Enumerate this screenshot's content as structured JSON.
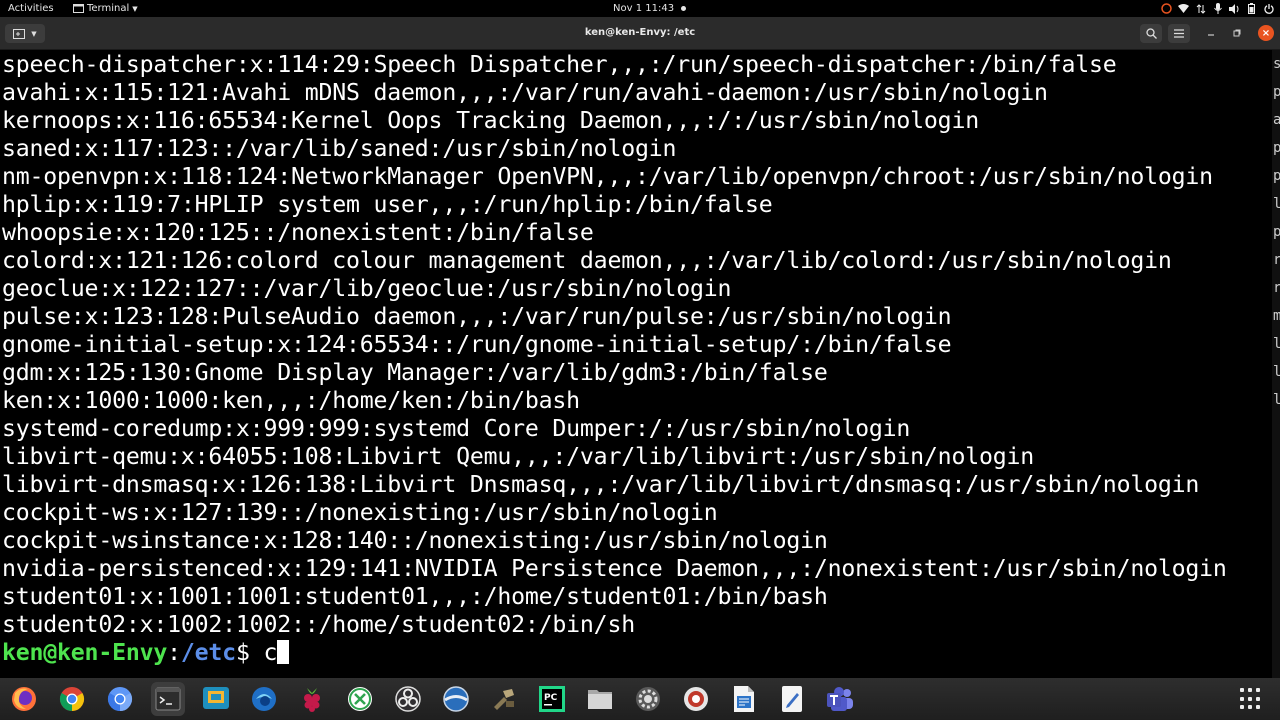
{
  "topbar": {
    "activities": "Activities",
    "app_menu": "Terminal",
    "clock": "Nov 1  11:43"
  },
  "window": {
    "title": "ken@ken-Envy: /etc"
  },
  "terminal": {
    "lines": [
      "speech-dispatcher:x:114:29:Speech Dispatcher,,,:/run/speech-dispatcher:/bin/false",
      "avahi:x:115:121:Avahi mDNS daemon,,,:/var/run/avahi-daemon:/usr/sbin/nologin",
      "kernoops:x:116:65534:Kernel Oops Tracking Daemon,,,:/:/usr/sbin/nologin",
      "saned:x:117:123::/var/lib/saned:/usr/sbin/nologin",
      "nm-openvpn:x:118:124:NetworkManager OpenVPN,,,:/var/lib/openvpn/chroot:/usr/sbin/nologin",
      "hplip:x:119:7:HPLIP system user,,,:/run/hplip:/bin/false",
      "whoopsie:x:120:125::/nonexistent:/bin/false",
      "colord:x:121:126:colord colour management daemon,,,:/var/lib/colord:/usr/sbin/nologin",
      "geoclue:x:122:127::/var/lib/geoclue:/usr/sbin/nologin",
      "pulse:x:123:128:PulseAudio daemon,,,:/var/run/pulse:/usr/sbin/nologin",
      "gnome-initial-setup:x:124:65534::/run/gnome-initial-setup/:/bin/false",
      "gdm:x:125:130:Gnome Display Manager:/var/lib/gdm3:/bin/false",
      "ken:x:1000:1000:ken,,,:/home/ken:/bin/bash",
      "systemd-coredump:x:999:999:systemd Core Dumper:/:/usr/sbin/nologin",
      "libvirt-qemu:x:64055:108:Libvirt Qemu,,,:/var/lib/libvirt:/usr/sbin/nologin",
      "libvirt-dnsmasq:x:126:138:Libvirt Dnsmasq,,,:/var/lib/libvirt/dnsmasq:/usr/sbin/nologin",
      "cockpit-ws:x:127:139::/nonexisting:/usr/sbin/nologin",
      "cockpit-wsinstance:x:128:140::/nonexisting:/usr/sbin/nologin",
      "nvidia-persistenced:x:129:141:NVIDIA Persistence Daemon,,,:/nonexistent:/usr/sbin/nologin",
      "student01:x:1001:1001:student01,,,:/home/student01:/bin/bash",
      "student02:x:1002:1002::/home/student02:/bin/sh"
    ],
    "prompt": {
      "user_host": "ken@ken-Envy",
      "colon": ":",
      "path": "/etc",
      "symbol": "$ ",
      "input": "c"
    }
  },
  "right_edge_glyphs": [
    "s",
    "p",
    "a",
    "p",
    "p",
    "l",
    "p",
    "r",
    "r",
    "m",
    "l",
    "l",
    "l"
  ],
  "dock": {
    "items": [
      "firefox-icon",
      "chrome-icon",
      "chromium-icon",
      "terminal-icon",
      "virt-manager-icon",
      "browser-icon",
      "raspberry-icon",
      "remote-desktop-icon",
      "obs-icon",
      "vpn-icon",
      "tools-icon",
      "pycharm-icon",
      "files-icon",
      "settings-icon",
      "vm-icon",
      "writer-icon",
      "text-editor-icon",
      "teams-icon"
    ],
    "active_item": "terminal-icon"
  },
  "colors": {
    "prompt_user": "#4ee44e",
    "prompt_path": "#5c8ee8",
    "close_button": "#e95420"
  }
}
